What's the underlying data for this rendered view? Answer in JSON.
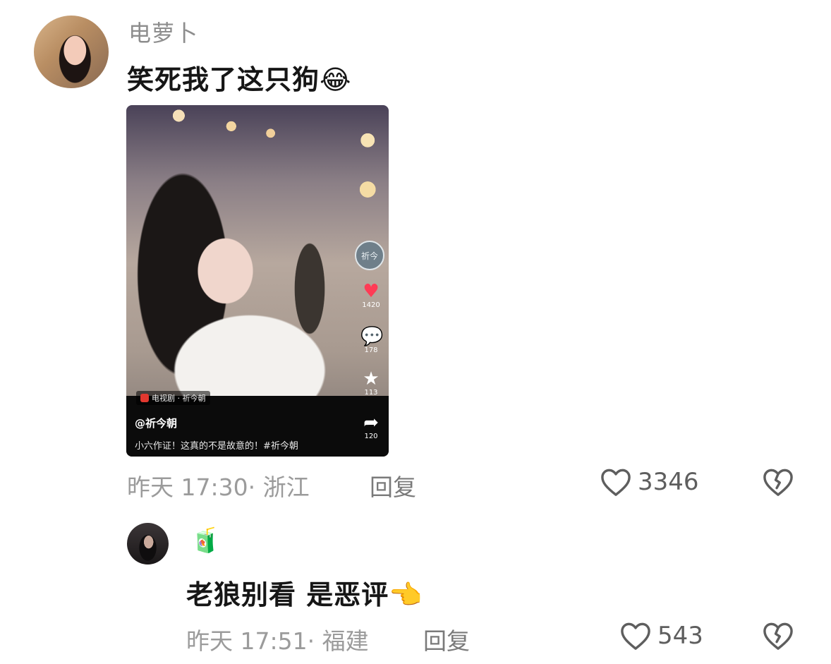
{
  "comment1": {
    "username": "电萝卜",
    "text": "笑死我了这只狗",
    "emoji": "😂",
    "time": "昨天 17:30",
    "location": "· 浙江",
    "reply_label": "回复",
    "likes": "3346",
    "video": {
      "tag": "电视剧 · 祈今朝",
      "author": "@祈今朝",
      "caption": "小六作证！这真的不是故意的！#祈今朝",
      "like_count": "1420",
      "comment_count": "178",
      "fav_count": "113",
      "share_count": "120",
      "side_avatar_text": "祈今"
    }
  },
  "comment2": {
    "username_emoji": "🧃",
    "text": "老狼别看 是恶评",
    "emoji": "👈",
    "time": "昨天 17:51",
    "location": "· 福建",
    "reply_label": "回复",
    "likes": "543"
  },
  "icons": {
    "like": "heart-outline-icon",
    "dislike": "broken-heart-icon"
  },
  "colors": {
    "meta_gray": "#9b9b9b",
    "text_dark": "#161616"
  }
}
